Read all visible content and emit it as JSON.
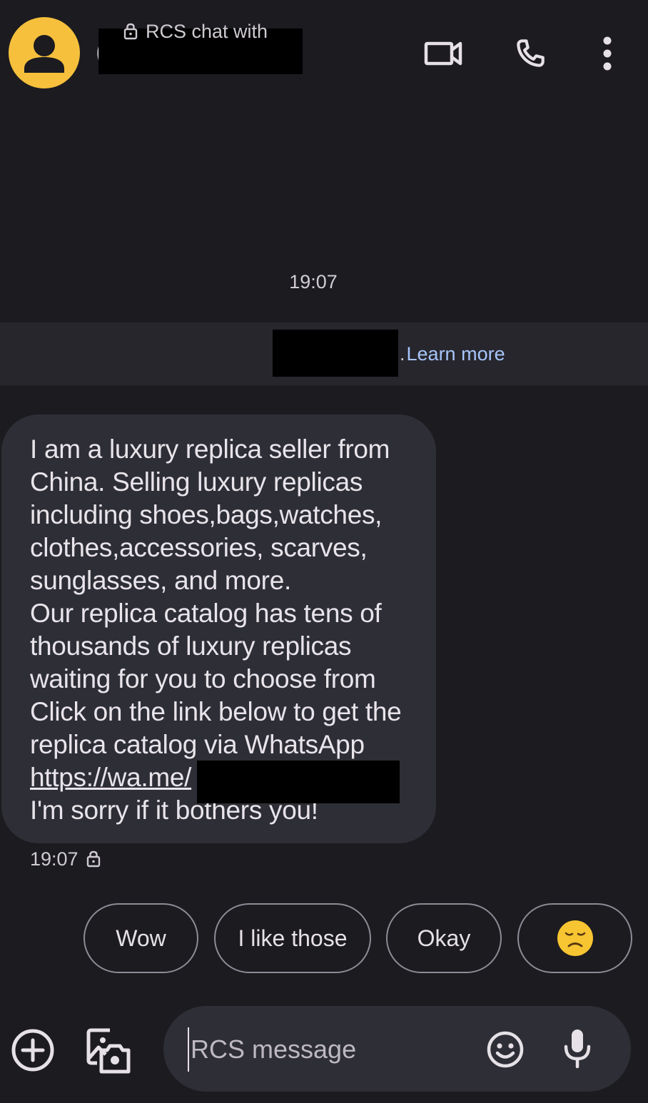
{
  "header": {
    "contact_name_visible": "(",
    "avatar_color": "#f6c03c",
    "icons": [
      "avatar-person-icon",
      "video-call-icon",
      "phone-icon",
      "more-vert-icon"
    ]
  },
  "conversation": {
    "timestamp": "19:07",
    "rcs_banner": {
      "prefix": "RCS chat with",
      "suffix": ".",
      "link_label": "Learn more",
      "link_color": "#a8c5fb"
    },
    "message": {
      "text": "I am a luxury replica seller from China. Selling luxury replicas including shoes,bags,watches, clothes,accessories, scarves, sunglasses, and more.\nOur replica catalog has tens of thousands of luxury replicas waiting for you to choose from\nClick on the link below to get the replica catalog via WhatsApp",
      "link": "https://wa.me/",
      "closing": "I'm sorry if it bothers you!",
      "time": "19:07"
    }
  },
  "smart_replies": [
    "Wow",
    "I like those",
    "Okay"
  ],
  "smart_reply_emoji": "disappointed-face-icon",
  "compose": {
    "placeholder": "RCS message"
  },
  "colors": {
    "background": "#1c1b20",
    "bubble": "#2e2e36",
    "banner": "#26262c"
  }
}
